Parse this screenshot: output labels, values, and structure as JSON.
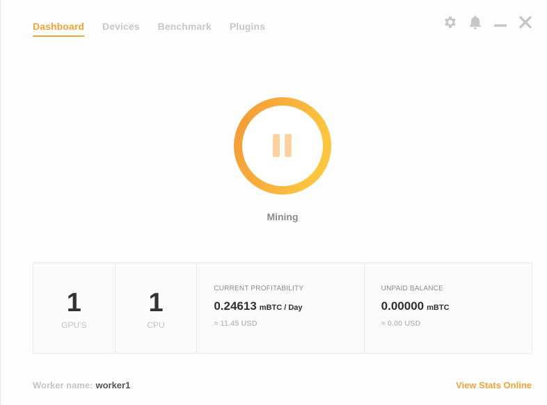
{
  "nav": {
    "tabs": [
      {
        "label": "Dashboard",
        "active": true
      },
      {
        "label": "Devices",
        "active": false
      },
      {
        "label": "Benchmark",
        "active": false
      },
      {
        "label": "Plugins",
        "active": false
      }
    ]
  },
  "window_controls": {
    "icons": [
      "gear-icon",
      "bell-icon",
      "minimize-icon",
      "close-icon"
    ]
  },
  "mining": {
    "status_label": "Mining",
    "icon": "pause-icon",
    "ring_gradient": [
      "#f39c3a",
      "#fbc23f"
    ],
    "pause_color": "#fcd3a0"
  },
  "stats": {
    "gpus": {
      "value": "1",
      "label": "GPU'S"
    },
    "cpu": {
      "value": "1",
      "label": "CPU"
    },
    "profitability": {
      "title": "CURRENT PROFITABILITY",
      "value": "0.24613",
      "unit": "mBTC / Day",
      "approx": "≈ 11.45 USD"
    },
    "balance": {
      "title": "UNPAID BALANCE",
      "value": "0.00000",
      "unit": "mBTC",
      "approx": "≈ 0.00 USD"
    }
  },
  "footer": {
    "worker_label": "Worker name:",
    "worker_value": "worker1",
    "stats_link": "View Stats Online"
  },
  "colors": {
    "accent": "#f0a437",
    "inactive_tab": "#c8c8c8",
    "icon_gray": "#c6c6c6"
  }
}
